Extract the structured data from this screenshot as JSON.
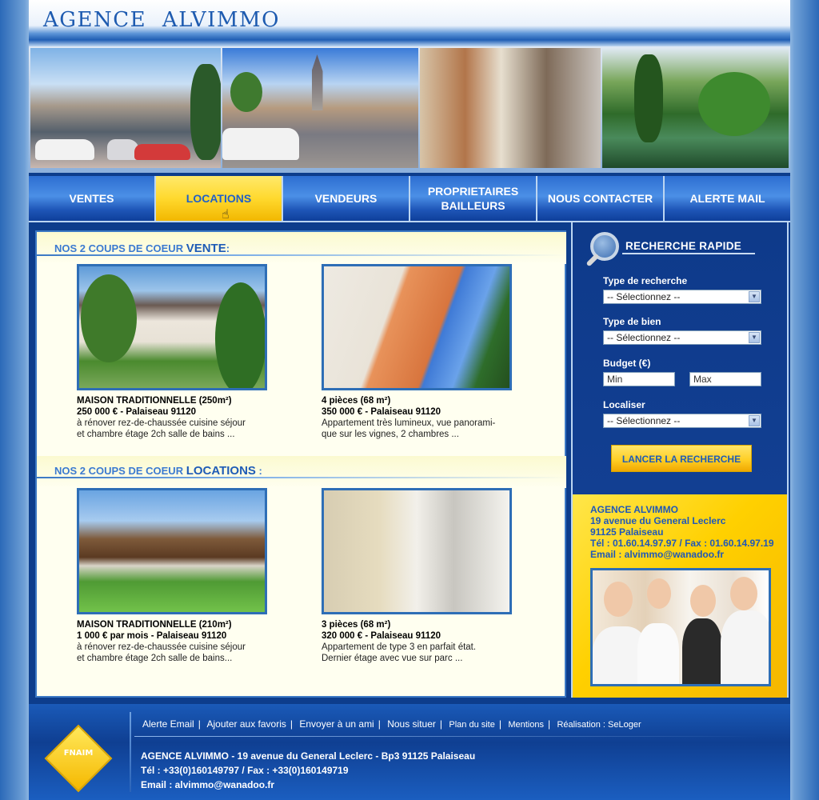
{
  "header": {
    "logo": "AGENCE  ALVIMMO"
  },
  "nav": {
    "items": [
      {
        "label": "VENTES"
      },
      {
        "label": "LOCATIONS",
        "active": true
      },
      {
        "label": "VENDEURS"
      },
      {
        "label": "PROPRIETAIRES\nBAILLEURS"
      },
      {
        "label": "NOUS CONTACTER"
      },
      {
        "label": "ALERTE MAIL"
      }
    ]
  },
  "sale_section": {
    "title_prefix": "NOS 2 COUPS DE COEUR ",
    "title_strong": "VENTE",
    "title_suffix": ":",
    "cards": [
      {
        "title": "MAISON TRADITIONNELLE (250m²)",
        "price": "250 000 € - Palaiseau 91120",
        "desc": "à rénover rez-de-chaussée cuisine séjour\net chambre étage 2ch salle de bains ..."
      },
      {
        "title": "4 pièces (68 m²)",
        "price": "350 000 € - Palaiseau 91120",
        "desc": "Appartement très lumineux, vue panorami-\nque sur les vignes, 2 chambres ..."
      }
    ]
  },
  "rent_section": {
    "title_prefix": "NOS 2 COUPS DE COEUR ",
    "title_strong": "LOCATIONS",
    "title_suffix": " :",
    "cards": [
      {
        "title": "MAISON TRADITIONNELLE (210m²)",
        "price": "1 000 € par mois - Palaiseau 91120",
        "desc": "à rénover rez-de-chaussée cuisine séjour\net chambre étage 2ch salle de bains..."
      },
      {
        "title": "3 pièces (68 m²)",
        "price": "320 000 € - Palaiseau 91120",
        "desc": "Appartement de type 3 en parfait état.\nDernier étage avec vue sur parc ..."
      }
    ]
  },
  "search": {
    "title": "RECHERCHE RAPIDE",
    "type_label": "Type de recherche",
    "type_value": "-- Sélectionnez --",
    "bien_label": "Type de bien",
    "bien_value": "-- Sélectionnez --",
    "budget_label": "Budget (€)",
    "min_placeholder": "Min",
    "max_placeholder": "Max",
    "loc_label": "Localiser",
    "loc_value": "-- Sélectionnez --",
    "button": "LANCER LA RECHERCHE"
  },
  "contact": {
    "name": "AGENCE ALVIMMO",
    "street": "19 avenue du General Leclerc",
    "city": "91125 Palaiseau",
    "phone": "Tél : 01.60.14.97.97 / Fax : 01.60.14.97.19",
    "email": "Email : alvimmo@wanadoo.fr"
  },
  "footer": {
    "links": [
      "Alerte Email",
      "Ajouter aux favoris",
      "Envoyer à un ami",
      "Nous situer",
      "Plan du site",
      "Mentions",
      "Réalisation : SeLoger"
    ],
    "address": "AGENCE ALVIMMO - 19 avenue du General Leclerc - Bp3 91125 Palaiseau",
    "phone": "Tél : +33(0)160149797 / Fax : +33(0)160149719",
    "email": "Email : alvimmo@wanadoo.fr",
    "fnaim": "FNAIM"
  }
}
